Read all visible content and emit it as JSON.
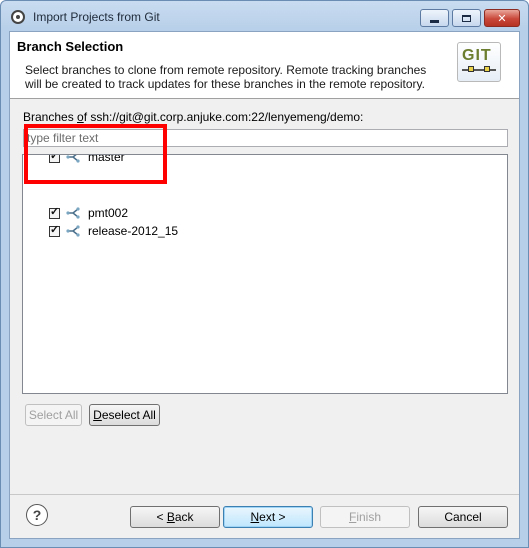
{
  "window": {
    "title": "Import Projects from Git"
  },
  "header": {
    "title": "Branch Selection",
    "description": "Select branches to clone from remote repository. Remote tracking branches will be created to track updates for these branches in the remote repository.",
    "logo_text": "GIT"
  },
  "branches": {
    "label_prefix": "Branches ",
    "label_mnemonic": "o",
    "label_rest": "f ssh://git@git.corp.anjuke.com:22/lenyemeng/demo:",
    "filter_placeholder": "type filter text",
    "items": [
      {
        "name": "master",
        "checked": true
      },
      {
        "name": "pmt002",
        "checked": true
      },
      {
        "name": "release-2012_15",
        "checked": true
      }
    ]
  },
  "selection_buttons": {
    "select_all": "Select All",
    "deselect_all_mnemonic": "D",
    "deselect_all_rest": "eselect All"
  },
  "footer": {
    "help_glyph": "?",
    "back_pre": "< ",
    "back_mnemonic": "B",
    "back_rest": "ack",
    "next_mnemonic": "N",
    "next_rest": "ext >",
    "finish_mnemonic": "F",
    "finish_rest": "inish",
    "cancel": "Cancel"
  },
  "colors": {
    "highlight_border": "#ff0000",
    "git_text": "#6b7d2e"
  }
}
